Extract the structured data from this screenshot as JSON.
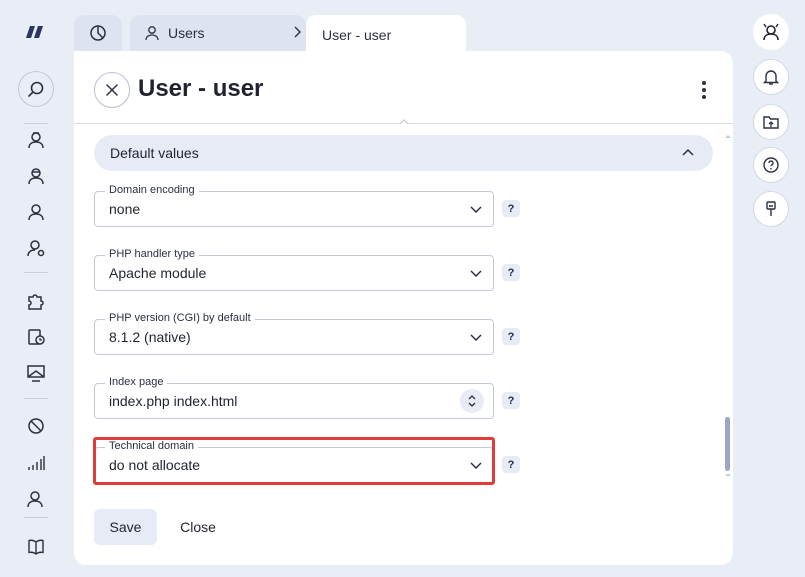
{
  "tabs": {
    "users_label": "Users",
    "active_label": "User - user"
  },
  "page": {
    "title": "User - user"
  },
  "section": {
    "title": "Default values"
  },
  "fields": [
    {
      "label": "Domain encoding",
      "value": "none",
      "help": "?"
    },
    {
      "label": "PHP handler type",
      "value": "Apache module",
      "help": "?"
    },
    {
      "label": "PHP version (CGI) by default",
      "value": "8.1.2 (native)",
      "help": "?"
    },
    {
      "label": "Index page",
      "value": "index.php index.html",
      "help": "?"
    },
    {
      "label": "Technical domain",
      "value": "do not allocate",
      "help": "?"
    }
  ],
  "actions": {
    "save_label": "Save",
    "close_label": "Close"
  },
  "colors": {
    "background": "#e9edf5",
    "accent_light": "#e6ebf5",
    "highlight": "#e03c3c"
  },
  "icons": {
    "left_sidebar": [
      "logo-icon",
      "search-icon",
      "admin-user-icon",
      "reseller-icon",
      "user-icon",
      "user-settings-icon",
      "puzzle-icon",
      "history-icon",
      "monitor-icon",
      "block-icon",
      "stats-icon",
      "user-shield-icon",
      "book-icon"
    ],
    "right_sidebar": [
      "avatar-icon",
      "bell-icon",
      "upload-folder-icon",
      "help-icon",
      "brush-icon"
    ]
  }
}
